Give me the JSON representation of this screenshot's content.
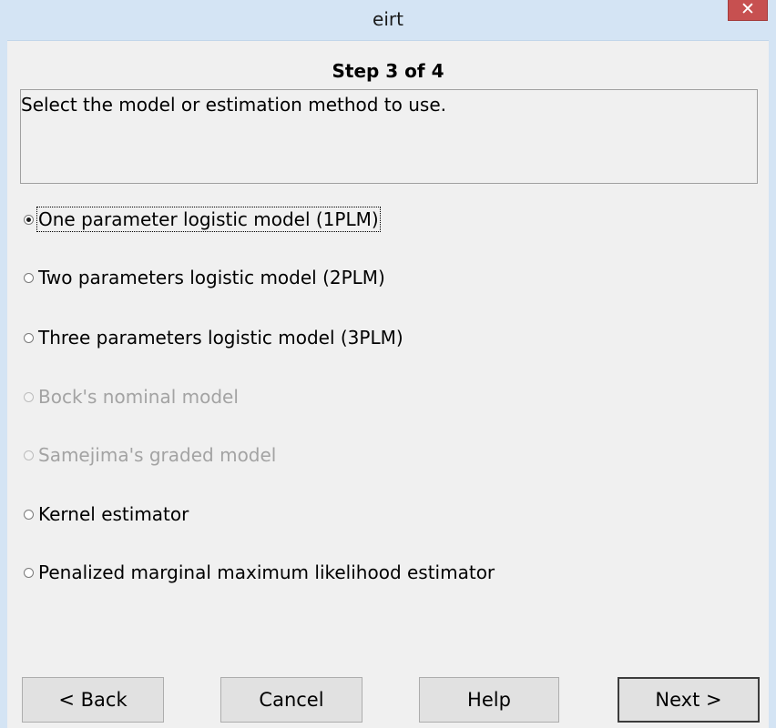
{
  "window": {
    "title": "eirt",
    "close_glyph": "✕"
  },
  "wizard": {
    "step_title": "Step 3 of 4",
    "description": "Select the model or estimation method to use."
  },
  "options": [
    {
      "label": "One parameter logistic model (1PLM)",
      "checked": true,
      "enabled": true
    },
    {
      "label": "Two parameters logistic model (2PLM)",
      "checked": false,
      "enabled": true
    },
    {
      "label": "Three parameters logistic model (3PLM)",
      "checked": false,
      "enabled": true
    },
    {
      "label": "Bock's nominal model",
      "checked": false,
      "enabled": false
    },
    {
      "label": "Samejima's graded model",
      "checked": false,
      "enabled": false
    },
    {
      "label": "Kernel estimator",
      "checked": false,
      "enabled": true
    },
    {
      "label": "Penalized marginal maximum likelihood estimator",
      "checked": false,
      "enabled": true
    }
  ],
  "buttons": {
    "back": "< Back",
    "cancel": "Cancel",
    "help": "Help",
    "next": "Next >"
  }
}
